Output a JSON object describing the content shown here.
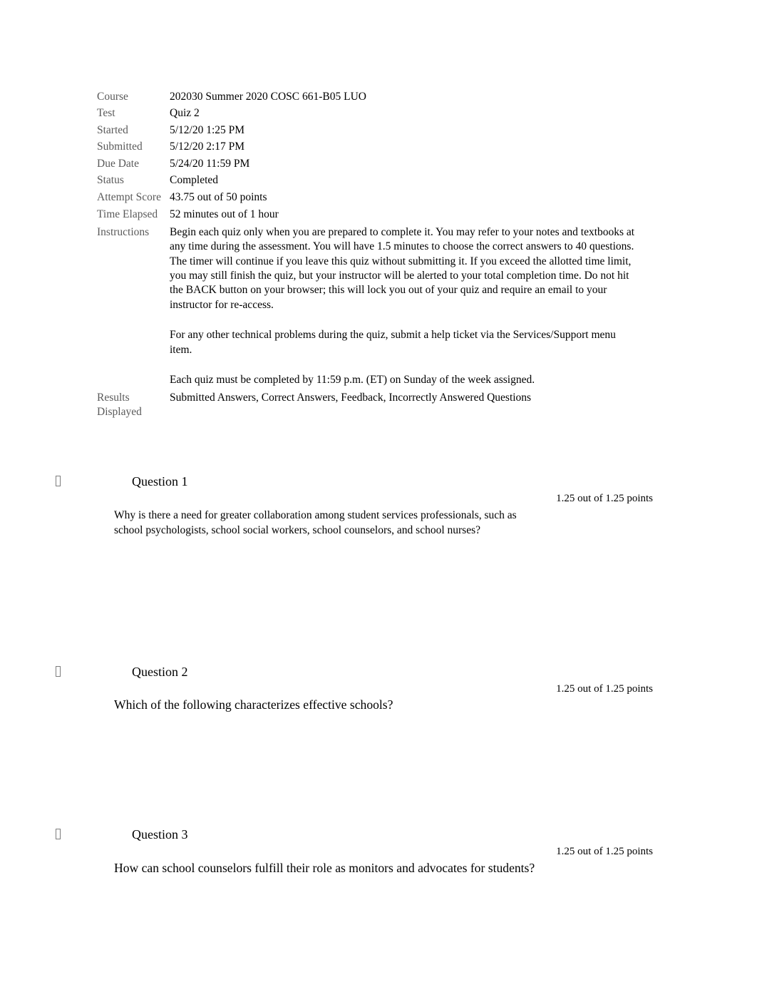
{
  "attempt_summary": {
    "rows": [
      {
        "label": "Course",
        "value": "202030 Summer 2020 COSC 661-B05 LUO"
      },
      {
        "label": "Test",
        "value": "Quiz 2"
      },
      {
        "label": "Started",
        "value": "5/12/20 1:25 PM"
      },
      {
        "label": "Submitted",
        "value": "5/12/20 2:17 PM"
      },
      {
        "label": "Due Date",
        "value": "5/24/20 11:59 PM"
      },
      {
        "label": "Status",
        "value": "Completed"
      },
      {
        "label": "Attempt Score",
        "value": "43.75 out of 50 points"
      },
      {
        "label": "Time Elapsed",
        "value": "52 minutes out of 1 hour"
      }
    ],
    "instructions_label": "Instructions",
    "instructions_paragraphs": [
      "Begin each quiz only when you are prepared to complete it. You may refer to your notes and textbooks at any time during the assessment. You will have 1.5 minutes to choose the correct answers to 40 questions. The timer will continue if you leave this quiz without submitting it. If you exceed the allotted time limit, you may still finish the quiz, but your instructor will be alerted to your total completion time. Do not hit the BACK button on your browser; this will lock you out of your quiz and require an email to your instructor for re-access.",
      "For any other technical problems during the quiz, submit a help ticket via the Services/Support menu item.",
      "Each quiz must be completed by 11:59 p.m. (ET) on Sunday of the week assigned."
    ],
    "results_displayed_label": "Results Displayed",
    "results_displayed_value": "Submitted Answers, Correct Answers, Feedback, Incorrectly Answered Questions"
  },
  "questions": [
    {
      "marker": "missing-glyph-box",
      "title": "Question 1",
      "points": "1.25 out of 1.25 points",
      "text": "Why is there a need for greater collaboration among student services professionals, such as school psychologists, school social workers, school counselors, and school nurses?"
    },
    {
      "marker": "missing-glyph-box",
      "title": "Question 2",
      "points": "1.25 out of 1.25 points",
      "text": "Which of the following characterizes effective schools?"
    },
    {
      "marker": "missing-glyph-box",
      "title": "Question 3",
      "points": "1.25 out of 1.25 points",
      "text": "How can school counselors fulfill their role as monitors and advocates for students?"
    }
  ]
}
